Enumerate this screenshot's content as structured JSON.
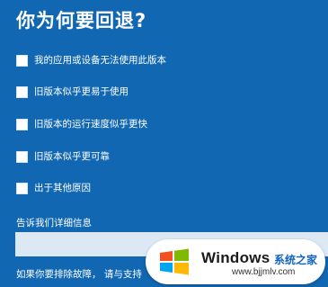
{
  "dialog": {
    "title": "你为何要回退?",
    "options": [
      "我的应用或设备无法使用此版本",
      "旧版本似乎更易于使用",
      "旧版本的运行速度似乎更快",
      "旧版本似乎更可靠",
      "出于其他原因"
    ],
    "detail_label": "告诉我们详细信息",
    "detail_value": "",
    "footer_text": "如果你要排除故障， 请与支持"
  },
  "watermark": {
    "brand": "Windows",
    "cn": "系统之家",
    "url": "www.bjjmlv.com",
    "logo_colors": [
      "#f25022",
      "#7fba00",
      "#00a4ef",
      "#ffb900"
    ]
  },
  "colors": {
    "background": "#1167b1"
  }
}
